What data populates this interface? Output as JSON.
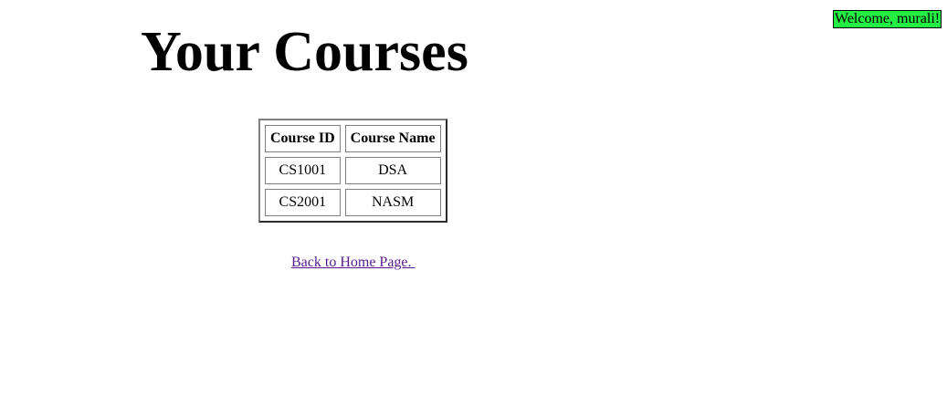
{
  "header": {
    "welcome_text": "Welcome, murali!",
    "welcome_bg": "#22ee44"
  },
  "main": {
    "title": "Your Courses",
    "table": {
      "headers": [
        "Course ID",
        "Course Name"
      ],
      "rows": [
        [
          "CS1001",
          "DSA"
        ],
        [
          "CS2001",
          "NASM"
        ]
      ]
    },
    "back_link": "Back to Home Page. ",
    "link_color": "#551a8b"
  }
}
